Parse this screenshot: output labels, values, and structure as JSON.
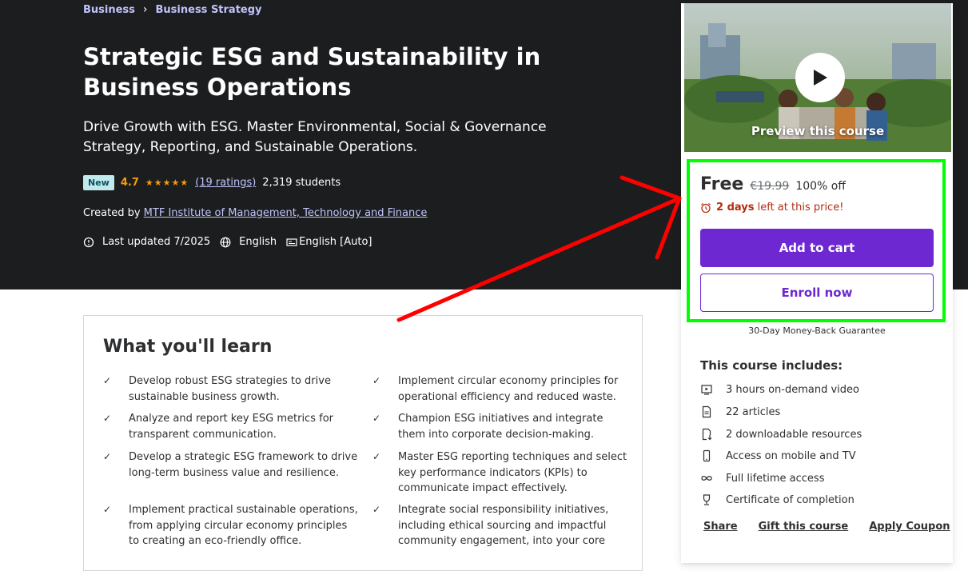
{
  "breadcrumb": {
    "items": [
      "Business",
      "Business Strategy"
    ],
    "sep": "›"
  },
  "course": {
    "title": "Strategic ESG and Sustainability in Business Operations",
    "subtitle": "Drive Growth with ESG. Master Environmental, Social & Governance Strategy, Reporting, and Sustainable Operations.",
    "badge": "New",
    "rating": "4.7",
    "stars": "★★★★★",
    "ratings_count": "(19 ratings)",
    "students": "2,319 students",
    "created_by_label": "Created by",
    "creator": "MTF Institute of Management, Technology and Finance",
    "last_updated": "Last updated 7/2025",
    "language": "English",
    "captions": "English [Auto]"
  },
  "learn": {
    "title": "What you'll learn",
    "items": [
      "Develop robust ESG strategies to drive sustainable business growth.",
      "Implement circular economy principles for operational efficiency and reduced waste.",
      "Analyze and report key ESG metrics for transparent communication.",
      "Champion ESG initiatives and integrate them into corporate decision-making.",
      "Develop a strategic ESG framework to drive long-term business value and resilience.",
      "Master ESG reporting techniques and select key performance indicators (KPIs) to communicate impact effectively.",
      "Implement practical sustainable operations, from applying circular economy principles to creating an eco-friendly office.",
      "Integrate social responsibility initiatives, including ethical sourcing and impactful community engagement, into your core"
    ]
  },
  "sidebar": {
    "preview_label": "Preview this course",
    "price": "Free",
    "original_price": "€19.99",
    "discount": "100% off",
    "timer_bold": "2 days",
    "timer_rest": "left at this price!",
    "add_to_cart": "Add to cart",
    "enroll_now": "Enroll now",
    "guarantee": "30-Day Money-Back Guarantee",
    "includes_title": "This course includes:",
    "includes": [
      {
        "icon": "video-icon",
        "label": "3 hours on-demand video"
      },
      {
        "icon": "article-icon",
        "label": "22 articles"
      },
      {
        "icon": "download-icon",
        "label": "2 downloadable resources"
      },
      {
        "icon": "mobile-icon",
        "label": "Access on mobile and TV"
      },
      {
        "icon": "infinity-icon",
        "label": "Full lifetime access"
      },
      {
        "icon": "trophy-icon",
        "label": "Certificate of completion"
      }
    ],
    "links": [
      "Share",
      "Gift this course",
      "Apply Coupon"
    ]
  },
  "colors": {
    "accent": "#6d28d2",
    "highlight": "#00ff00",
    "arrow": "#ff0000",
    "timer": "#b32d0f"
  }
}
